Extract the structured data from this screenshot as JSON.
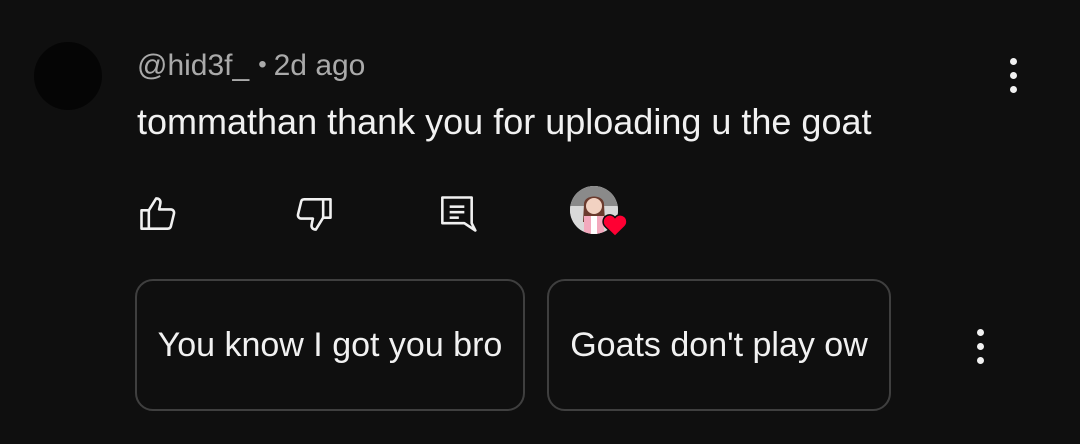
{
  "comment": {
    "handle": "@hid3f_",
    "separator": "•",
    "time": "2d ago",
    "text": "tommathan thank you for uploading u the goat"
  },
  "actions": {
    "like_icon": "thumb-up-icon",
    "dislike_icon": "thumb-down-icon",
    "reply_icon": "reply-comment-icon",
    "creator_heart_icon": "creator-heart-icon"
  },
  "suggested_replies": [
    {
      "label": "You know I got you bro"
    },
    {
      "label": "Goats don't play ow"
    }
  ],
  "colors": {
    "background": "#0f0f0f",
    "text_primary": "#f1f1f1",
    "text_secondary": "#aaaaaa",
    "chip_border": "#3f3f3f",
    "heart": "#ff0033"
  }
}
